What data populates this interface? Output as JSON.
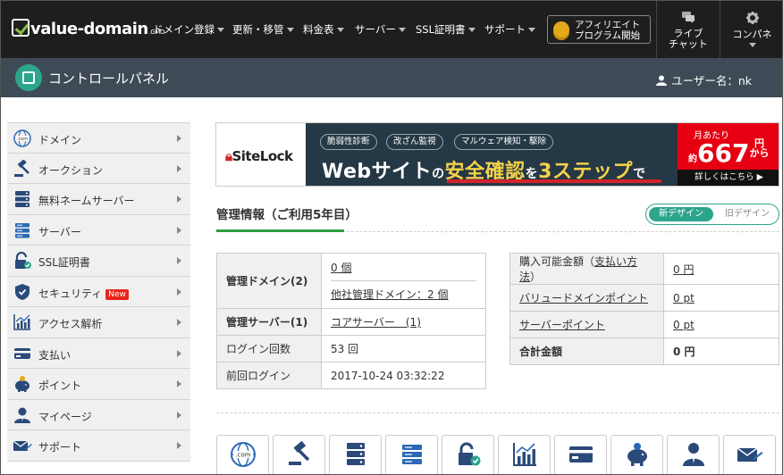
{
  "nav": {
    "logo": "value-domain",
    "logo_sub": ".GMO",
    "items": [
      {
        "label": "ドメイン登録"
      },
      {
        "label": "更新・移管"
      },
      {
        "label": "料金表"
      },
      {
        "label": "サーバー"
      },
      {
        "label": "SSL証明書"
      },
      {
        "label": "サポート"
      }
    ],
    "affiliate": {
      "line1": "アフィリエイト",
      "line2": "プログラム開始"
    },
    "live_chat": {
      "line1": "ライブ",
      "line2": "チャット"
    },
    "compass": {
      "label": "コンパネ"
    }
  },
  "header": {
    "title": "コントロールパネル",
    "user_label": "ユーザー名：",
    "username": "nk"
  },
  "sidebar": {
    "items": [
      {
        "label": "ドメイン",
        "icon": "globe-com-icon"
      },
      {
        "label": "オークション",
        "icon": "gavel-icon"
      },
      {
        "label": "無料ネームサーバー",
        "icon": "server-stack-icon"
      },
      {
        "label": "サーバー",
        "icon": "server-icon"
      },
      {
        "label": "SSL証明書",
        "icon": "lock-icon"
      },
      {
        "label": "セキュリティ",
        "icon": "shield-icon",
        "badge": "New"
      },
      {
        "label": "アクセス解析",
        "icon": "chart-icon"
      },
      {
        "label": "支払い",
        "icon": "card-icon"
      },
      {
        "label": "ポイント",
        "icon": "piggy-bank-icon"
      },
      {
        "label": "マイページ",
        "icon": "user-icon"
      },
      {
        "label": "サポート",
        "icon": "mail-icon"
      }
    ]
  },
  "banner": {
    "brand": "SiteLock",
    "pills": [
      "脆弱性診断",
      "改ざん監視",
      "マルウェア検知・駆除"
    ],
    "headline": {
      "p1": "Webサイト",
      "p2": "の",
      "p3": "安全確認",
      "p4": "を",
      "p5": "3ステップ",
      "p6": "で"
    },
    "price_prefix": "月あたり",
    "price_approx": "約",
    "price": "667",
    "price_unit": "円",
    "price_suffix": "から",
    "cta": "詳しくはこちら ▶"
  },
  "management": {
    "title": "管理情報（ご利用5年目）",
    "toggle_new": "新デザイン",
    "toggle_old": "旧デザイン",
    "left": {
      "domains_label": "管理ドメイン(2)",
      "domains_value": "0 個",
      "domains_other": "他社管理ドメイン：2 個",
      "servers_label": "管理サーバー(1)",
      "servers_value": "コアサーバー　(1)",
      "login_count_label": "ログイン回数",
      "login_count_value": "53 回",
      "last_login_label": "前回ログイン",
      "last_login_value": "2017-10-24 03:32:22"
    },
    "right": {
      "purchasable_label": "購入可能金額（",
      "purchasable_link": "支払い方法",
      "purchasable_close": "）",
      "purchasable_value": "0 円",
      "vd_points_label": "バリュードメインポイント",
      "vd_points_value": "0 pt",
      "server_points_label": "サーバーポイント",
      "server_points_value": "0 pt",
      "total_label": "合計金額",
      "total_value": "0 円"
    }
  },
  "bottom_icons": [
    "globe-com-icon",
    "gavel-icon",
    "server-stack-icon",
    "server-icon",
    "lock-icon",
    "chart-icon",
    "card-icon",
    "piggy-bank-icon",
    "user-icon",
    "mail-icon"
  ],
  "colors": {
    "accent": "#2ca58d",
    "nav_bg": "#1e1e1e",
    "header_bg": "#3e4a55",
    "sidebar_bg": "#f0f0f0",
    "sitelock_red": "#e60012"
  }
}
